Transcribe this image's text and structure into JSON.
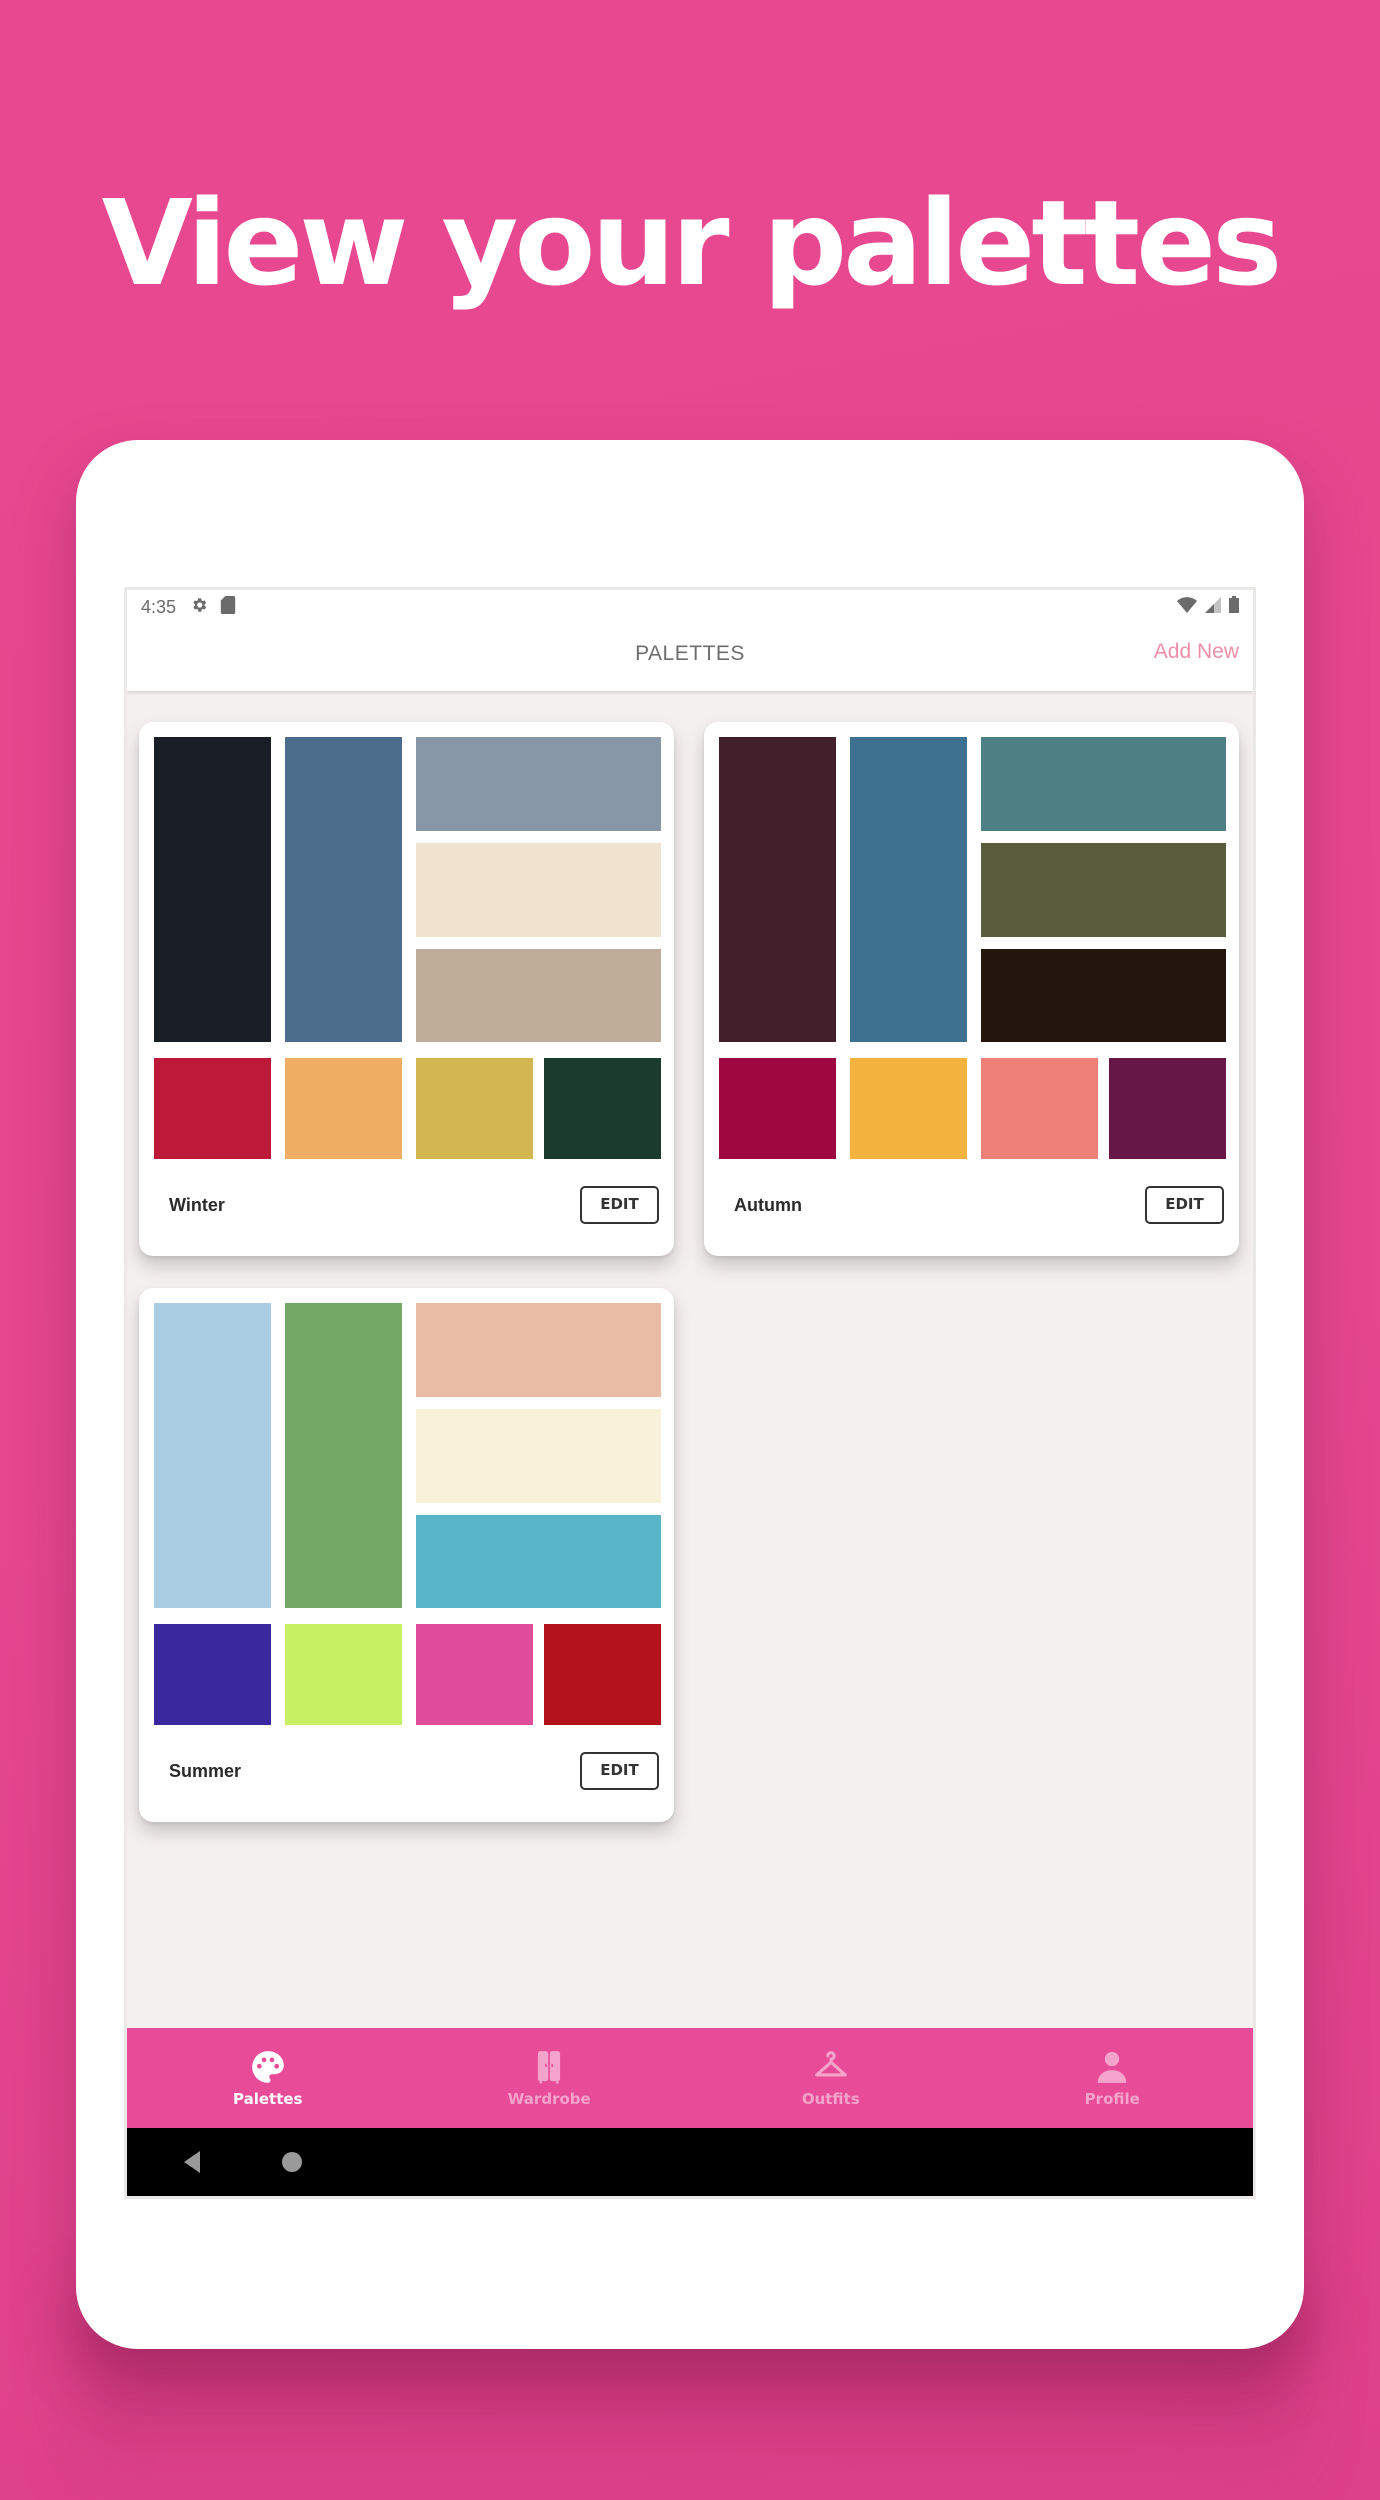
{
  "headline": "View your palettes",
  "status_bar": {
    "time": "4:35",
    "left_icons": [
      "gear-icon",
      "sd-card-icon"
    ],
    "right_icons": [
      "wifi-icon",
      "signal-icon",
      "battery-icon"
    ]
  },
  "app_bar": {
    "title": "PALETTES",
    "action_label": "Add New",
    "action_color": "#ee8fa8"
  },
  "palettes": [
    {
      "name": "Winter",
      "edit_label": "EDIT",
      "tall": [
        "#1a1e27",
        "#4c6d8c"
      ],
      "stacked": [
        "#8897a6",
        "#f1e3cf",
        "#bfad99"
      ],
      "bottom": [
        "#bc1a38",
        "#f0ae64",
        "#d3b64f",
        "#1b3b2f"
      ]
    },
    {
      "name": "Autumn",
      "edit_label": "EDIT",
      "tall": [
        "#41202c",
        "#3e7190"
      ],
      "stacked": [
        "#4d8085",
        "#5a5d3d",
        "#24150f"
      ],
      "bottom": [
        "#9e0840",
        "#f4b23f",
        "#ef8078",
        "#671648"
      ]
    },
    {
      "name": "Summer",
      "edit_label": "EDIT",
      "tall": [
        "#abcde3",
        "#73a866"
      ],
      "stacked": [
        "#e9bda3",
        "#f9f1da",
        "#59b6c8"
      ],
      "bottom": [
        "#3a289e",
        "#c7f163",
        "#e04d9d",
        "#b3121c"
      ]
    }
  ],
  "bottom_nav": {
    "items": [
      {
        "label": "Palettes",
        "icon": "palette-icon",
        "active": true
      },
      {
        "label": "Wardrobe",
        "icon": "wardrobe-icon",
        "active": false
      },
      {
        "label": "Outfits",
        "icon": "hanger-icon",
        "active": false
      },
      {
        "label": "Profile",
        "icon": "person-icon",
        "active": false
      }
    ],
    "background": "#e84c98"
  },
  "system_nav": {
    "buttons": [
      "back-icon",
      "home-icon"
    ]
  }
}
